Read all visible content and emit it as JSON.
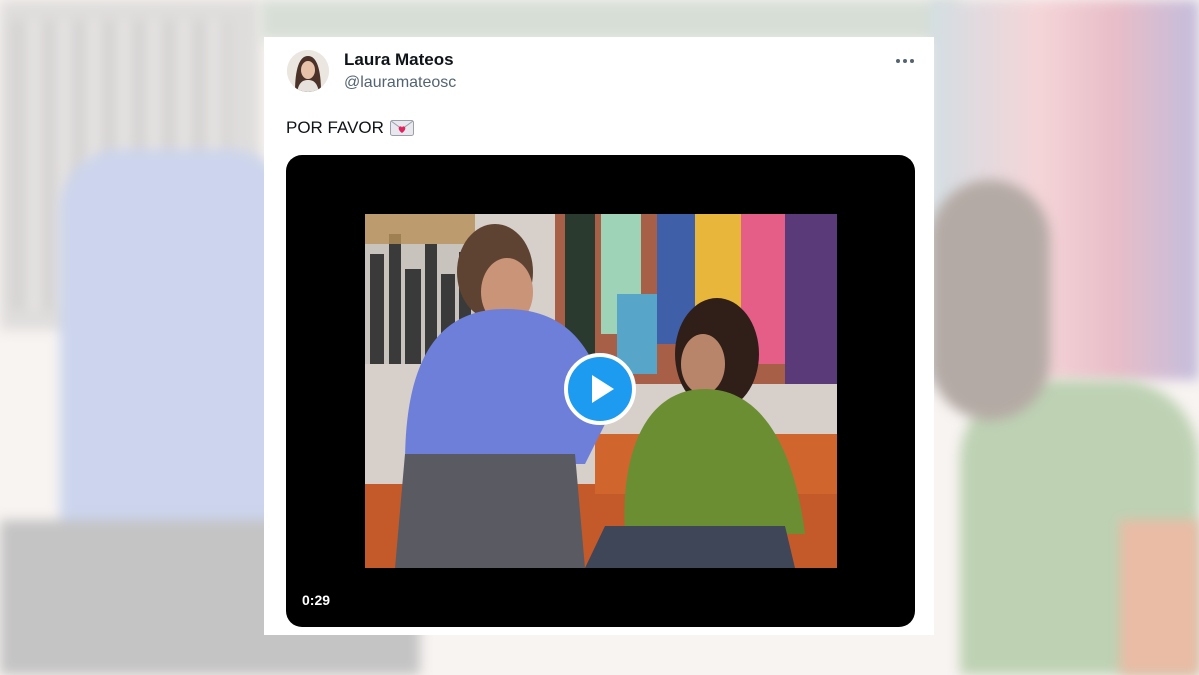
{
  "tweet": {
    "author_name": "Laura Mateos",
    "author_handle": "@lauramateosc",
    "text": "POR FAVOR",
    "emoji_icon": "love-letter-icon",
    "more_icon": "more-options-icon"
  },
  "video": {
    "duration": "0:29",
    "play_icon": "play-icon"
  },
  "colors": {
    "accent": "#1d9bf0",
    "name": "#0f1419",
    "secondary": "#536471"
  }
}
